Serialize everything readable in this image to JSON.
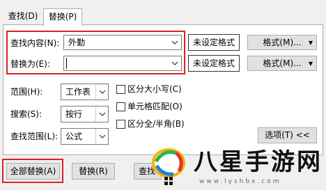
{
  "tabs": [
    {
      "label": "查找(D)"
    },
    {
      "label": "替换(P)"
    }
  ],
  "find": {
    "label": "查找内容(N):",
    "value": "外勤",
    "format_status": "未设定格式",
    "format_button": "格式(M)..."
  },
  "replace": {
    "label": "替换为(E):",
    "value": "",
    "format_status": "未设定格式",
    "format_button": "格式(M)..."
  },
  "options": {
    "scope_label": "范围(H):",
    "scope_value": "工作表",
    "search_label": "搜索(S):",
    "search_value": "按行",
    "lookin_label": "查找范围(L):",
    "lookin_value": "公式",
    "match_case": "区分大小写(C)",
    "match_cell": "单元格匹配(O)",
    "match_width": "区分全/半角(B)",
    "options_button": "选项(T) <<"
  },
  "buttons": {
    "replace_all": "全部替换(A)",
    "replace": "替换(R)",
    "find_partial": "查找"
  },
  "watermark": {
    "text": "八星手游网",
    "url": "www.lyshbx.com"
  },
  "colors": {
    "highlight": "#e02020",
    "dialog_bg": "#f0f0f0",
    "panel_bg": "#ffffff",
    "button_bg": "#e1e1e1"
  }
}
